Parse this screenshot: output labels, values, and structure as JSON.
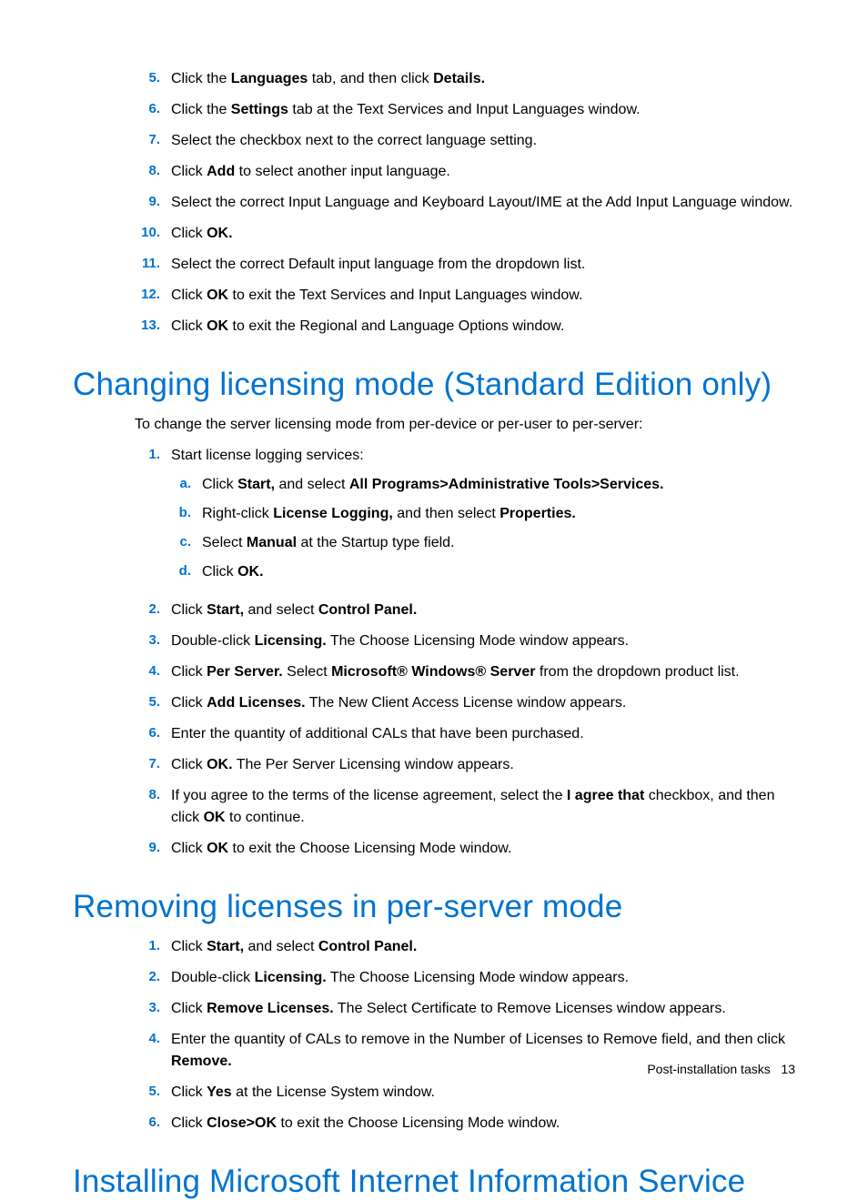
{
  "section1": {
    "items": [
      {
        "num": "5.",
        "runs": [
          "Click the ",
          [
            "b",
            "Languages"
          ],
          " tab, and then click ",
          [
            "b",
            "Details."
          ]
        ]
      },
      {
        "num": "6.",
        "runs": [
          "Click the ",
          [
            "b",
            "Settings"
          ],
          " tab at the Text Services and Input Languages window."
        ]
      },
      {
        "num": "7.",
        "runs": [
          "Select the checkbox next to the correct language setting."
        ]
      },
      {
        "num": "8.",
        "runs": [
          "Click ",
          [
            "b",
            "Add"
          ],
          " to select another input language."
        ]
      },
      {
        "num": "9.",
        "runs": [
          "Select the correct Input Language and Keyboard Layout/IME at the Add Input Language window."
        ]
      },
      {
        "num": "10.",
        "runs": [
          "Click ",
          [
            "b",
            "OK."
          ]
        ]
      },
      {
        "num": "11.",
        "runs": [
          "Select the correct Default input language from the dropdown list."
        ]
      },
      {
        "num": "12.",
        "runs": [
          "Click ",
          [
            "b",
            "OK"
          ],
          " to exit the Text Services and Input Languages window."
        ]
      },
      {
        "num": "13.",
        "runs": [
          "Click ",
          [
            "b",
            "OK"
          ],
          " to exit the Regional and Language Options window."
        ]
      }
    ]
  },
  "section2": {
    "heading": "Changing licensing mode (Standard Edition only)",
    "intro": "To change the server licensing mode from per-device or per-user to per-server:",
    "items": [
      {
        "num": "1.",
        "runs": [
          "Start license logging services:"
        ],
        "sub": [
          {
            "num": "a.",
            "runs": [
              "Click ",
              [
                "b",
                "Start,"
              ],
              " and select ",
              [
                "b",
                "All Programs>Administrative Tools>Services."
              ]
            ]
          },
          {
            "num": "b.",
            "runs": [
              "Right-click ",
              [
                "b",
                "License Logging,"
              ],
              " and then select ",
              [
                "b",
                "Properties."
              ]
            ]
          },
          {
            "num": "c.",
            "runs": [
              "Select ",
              [
                "b",
                "Manual"
              ],
              " at the Startup type field."
            ]
          },
          {
            "num": "d.",
            "runs": [
              "Click ",
              [
                "b",
                "OK."
              ]
            ]
          }
        ]
      },
      {
        "num": "2.",
        "runs": [
          "Click ",
          [
            "b",
            "Start,"
          ],
          " and select ",
          [
            "b",
            "Control Panel."
          ]
        ]
      },
      {
        "num": "3.",
        "runs": [
          "Double-click ",
          [
            "b",
            "Licensing."
          ],
          " The Choose Licensing Mode window appears."
        ]
      },
      {
        "num": "4.",
        "runs": [
          "Click ",
          [
            "b",
            "Per Server."
          ],
          " Select ",
          [
            "b",
            "Microsoft® Windows® Server"
          ],
          " from the dropdown product list."
        ]
      },
      {
        "num": "5.",
        "runs": [
          "Click ",
          [
            "b",
            "Add Licenses."
          ],
          " The New Client Access License window appears."
        ]
      },
      {
        "num": "6.",
        "runs": [
          "Enter the quantity of additional CALs that have been purchased."
        ]
      },
      {
        "num": "7.",
        "runs": [
          "Click ",
          [
            "b",
            "OK."
          ],
          " The Per Server Licensing window appears."
        ]
      },
      {
        "num": "8.",
        "runs": [
          "If you agree to the terms of the license agreement, select the ",
          [
            "b",
            "I agree that"
          ],
          " checkbox, and then click ",
          [
            "b",
            "OK"
          ],
          " to continue."
        ]
      },
      {
        "num": "9.",
        "runs": [
          "Click ",
          [
            "b",
            "OK"
          ],
          " to exit the Choose Licensing Mode window."
        ]
      }
    ]
  },
  "section3": {
    "heading": "Removing licenses in per-server mode",
    "items": [
      {
        "num": "1.",
        "runs": [
          "Click ",
          [
            "b",
            "Start,"
          ],
          " and select ",
          [
            "b",
            "Control Panel."
          ]
        ]
      },
      {
        "num": "2.",
        "runs": [
          "Double-click ",
          [
            "b",
            "Licensing."
          ],
          " The Choose Licensing Mode window appears."
        ]
      },
      {
        "num": "3.",
        "runs": [
          "Click ",
          [
            "b",
            "Remove Licenses."
          ],
          " The Select Certificate to Remove Licenses window appears."
        ]
      },
      {
        "num": "4.",
        "runs": [
          "Enter the quantity of CALs to remove in the Number of Licenses to Remove field, and then click ",
          [
            "b",
            "Remove."
          ]
        ]
      },
      {
        "num": "5.",
        "runs": [
          "Click ",
          [
            "b",
            "Yes"
          ],
          " at the License System window."
        ]
      },
      {
        "num": "6.",
        "runs": [
          "Click ",
          [
            "b",
            "Close>OK"
          ],
          " to exit the Choose Licensing Mode window."
        ]
      }
    ]
  },
  "section4": {
    "heading": "Installing Microsoft Internet Information Service"
  },
  "footer": {
    "label": "Post-installation tasks",
    "page": "13"
  }
}
